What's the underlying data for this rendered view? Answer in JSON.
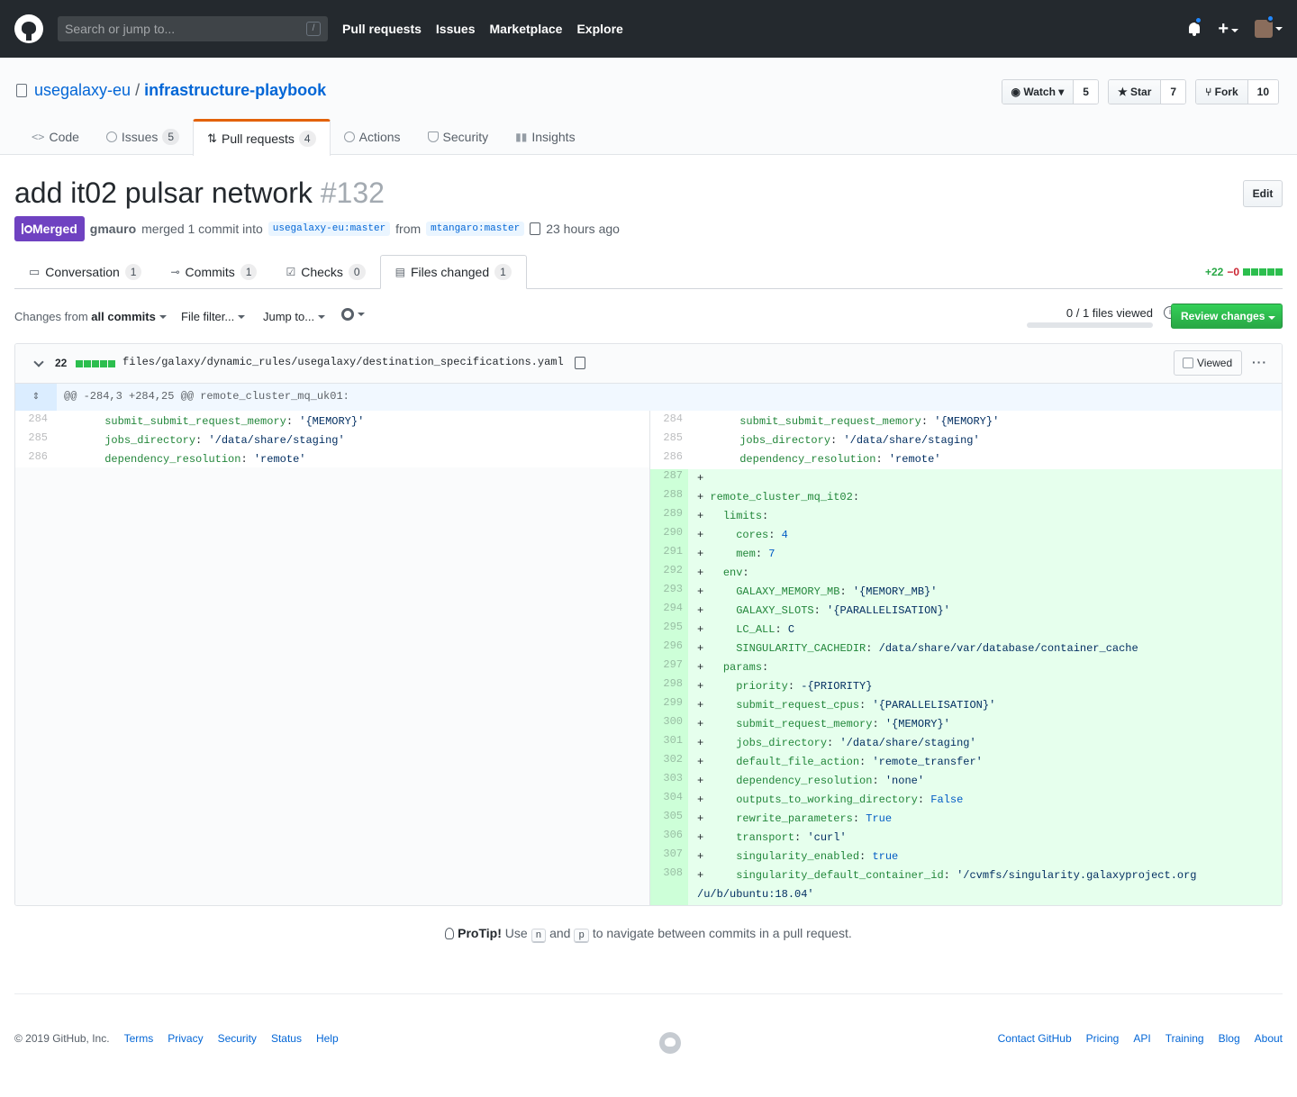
{
  "header": {
    "search_placeholder": "Search or jump to...",
    "search_key": "/",
    "nav": [
      "Pull requests",
      "Issues",
      "Marketplace",
      "Explore"
    ],
    "plus": "+"
  },
  "repo": {
    "owner": "usegalaxy-eu",
    "separator": "/",
    "name": "infrastructure-playbook",
    "watch_label": "Watch",
    "watch_count": "5",
    "star_label": "Star",
    "star_count": "7",
    "fork_label": "Fork",
    "fork_count": "10",
    "tabs": [
      {
        "label": "Code",
        "count": ""
      },
      {
        "label": "Issues",
        "count": "5"
      },
      {
        "label": "Pull requests",
        "count": "4"
      },
      {
        "label": "Actions",
        "count": ""
      },
      {
        "label": "Security",
        "count": ""
      },
      {
        "label": "Insights",
        "count": ""
      }
    ]
  },
  "pr": {
    "title": "add it02 pulsar network",
    "number": "#132",
    "edit_label": "Edit",
    "state": "Merged",
    "author": "gmauro",
    "merged_text": "merged 1 commit into",
    "base_branch": "usegalaxy-eu:master",
    "from_text": "from",
    "head_branch": "mtangaro:master",
    "time": "23 hours ago",
    "tabs": [
      {
        "label": "Conversation",
        "count": "1"
      },
      {
        "label": "Commits",
        "count": "1"
      },
      {
        "label": "Checks",
        "count": "0"
      },
      {
        "label": "Files changed",
        "count": "1"
      }
    ],
    "additions": "+22",
    "deletions": "−0"
  },
  "toolbar": {
    "changes_from": "Changes from",
    "all_commits": "all commits",
    "file_filter": "File filter...",
    "jump_to": "Jump to...",
    "files_viewed": "0 / 1 files viewed",
    "review_button": "Review changes"
  },
  "file": {
    "count": "22",
    "path": "files/galaxy/dynamic_rules/usegalaxy/destination_specifications.yaml",
    "viewed_label": "Viewed",
    "more": "···",
    "hunk": "@@ -284,3 +284,25 @@ remote_cluster_mq_uk01:",
    "context": [
      {
        "ln": "284",
        "indent": "      ",
        "key": "submit_submit_request_memory",
        "val": "'{MEMORY}'",
        "vtype": "str"
      },
      {
        "ln": "285",
        "indent": "      ",
        "key": "jobs_directory",
        "val": "'/data/share/staging'",
        "vtype": "str"
      },
      {
        "ln": "286",
        "indent": "      ",
        "key": "dependency_resolution",
        "val": "'remote'",
        "vtype": "str"
      }
    ],
    "added": [
      {
        "ln": "287",
        "indent": "",
        "key": "",
        "val": "",
        "vtype": "str"
      },
      {
        "ln": "288",
        "indent": "",
        "key": "remote_cluster_mq_it02",
        "val": "",
        "vtype": "str"
      },
      {
        "ln": "289",
        "indent": "  ",
        "key": "limits",
        "val": "",
        "vtype": "str"
      },
      {
        "ln": "290",
        "indent": "    ",
        "key": "cores",
        "val": "4",
        "vtype": "num"
      },
      {
        "ln": "291",
        "indent": "    ",
        "key": "mem",
        "val": "7",
        "vtype": "num"
      },
      {
        "ln": "292",
        "indent": "  ",
        "key": "env",
        "val": "",
        "vtype": "str"
      },
      {
        "ln": "293",
        "indent": "    ",
        "key": "GALAXY_MEMORY_MB",
        "val": "'{MEMORY_MB}'",
        "vtype": "str"
      },
      {
        "ln": "294",
        "indent": "    ",
        "key": "GALAXY_SLOTS",
        "val": "'{PARALLELISATION}'",
        "vtype": "str"
      },
      {
        "ln": "295",
        "indent": "    ",
        "key": "LC_ALL",
        "val": "C",
        "vtype": "str"
      },
      {
        "ln": "296",
        "indent": "    ",
        "key": "SINGULARITY_CACHEDIR",
        "val": "/data/share/var/database/container_cache",
        "vtype": "str"
      },
      {
        "ln": "297",
        "indent": "  ",
        "key": "params",
        "val": "",
        "vtype": "str"
      },
      {
        "ln": "298",
        "indent": "    ",
        "key": "priority",
        "val": "-{PRIORITY}",
        "vtype": "str"
      },
      {
        "ln": "299",
        "indent": "    ",
        "key": "submit_request_cpus",
        "val": "'{PARALLELISATION}'",
        "vtype": "str"
      },
      {
        "ln": "300",
        "indent": "    ",
        "key": "submit_request_memory",
        "val": "'{MEMORY}'",
        "vtype": "str"
      },
      {
        "ln": "301",
        "indent": "    ",
        "key": "jobs_directory",
        "val": "'/data/share/staging'",
        "vtype": "str"
      },
      {
        "ln": "302",
        "indent": "    ",
        "key": "default_file_action",
        "val": "'remote_transfer'",
        "vtype": "str"
      },
      {
        "ln": "303",
        "indent": "    ",
        "key": "dependency_resolution",
        "val": "'none'",
        "vtype": "str"
      },
      {
        "ln": "304",
        "indent": "    ",
        "key": "outputs_to_working_directory",
        "val": "False",
        "vtype": "num"
      },
      {
        "ln": "305",
        "indent": "    ",
        "key": "rewrite_parameters",
        "val": "True",
        "vtype": "num"
      },
      {
        "ln": "306",
        "indent": "    ",
        "key": "transport",
        "val": "'curl'",
        "vtype": "str"
      },
      {
        "ln": "307",
        "indent": "    ",
        "key": "singularity_enabled",
        "val": "true",
        "vtype": "num"
      },
      {
        "ln": "308",
        "indent": "    ",
        "key": "singularity_default_container_id",
        "val": "'/cvmfs/singularity.galaxyproject.org",
        "vtype": "str"
      }
    ],
    "wrap_line": "/u/b/ubuntu:18.04'"
  },
  "protip": {
    "label": "ProTip!",
    "use": "Use",
    "key1": "n",
    "and": "and",
    "key2": "p",
    "rest": "to navigate between commits in a pull request."
  },
  "footer": {
    "copyright": "© 2019 GitHub, Inc.",
    "left_links": [
      "Terms",
      "Privacy",
      "Security",
      "Status",
      "Help"
    ],
    "right_links": [
      "Contact GitHub",
      "Pricing",
      "API",
      "Training",
      "Blog",
      "About"
    ]
  },
  "colors": {
    "header_bg": "#24292e",
    "merged": "#6f42c1",
    "addition_bg": "#e6ffed",
    "addition_gutter": "#cdffd8",
    "primary_green": "#28a745",
    "link": "#0366d6",
    "tab_accent": "#e36209"
  }
}
